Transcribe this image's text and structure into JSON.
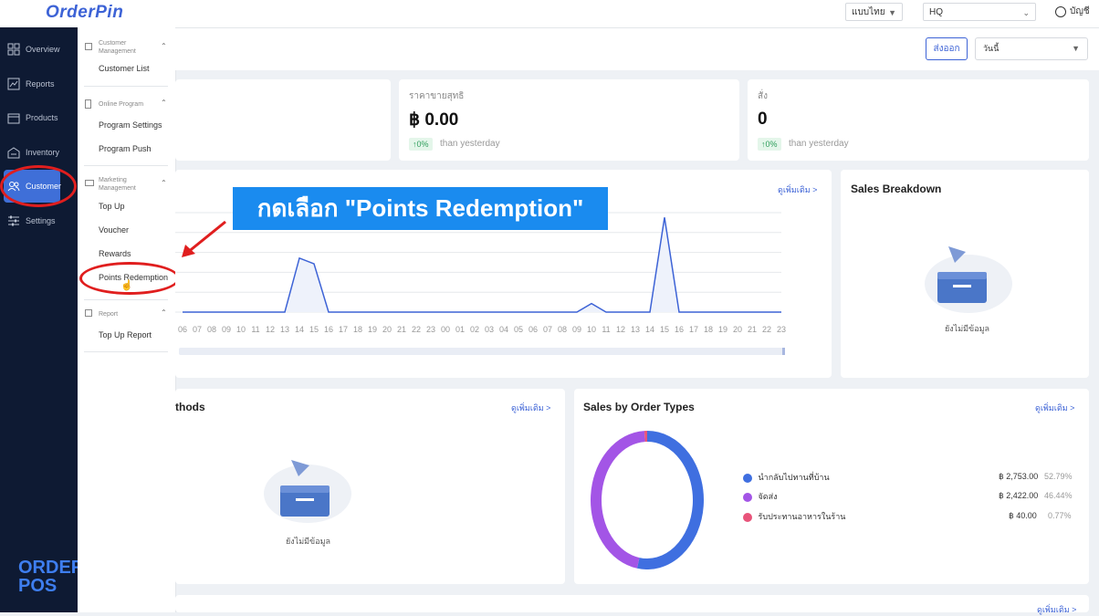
{
  "app": {
    "logo": "OrderPin"
  },
  "topbar": {
    "language": "แบบไทย",
    "branch": "HQ",
    "account": "บัญชี"
  },
  "rail": {
    "items": [
      {
        "label": "Overview",
        "icon": "grid-icon"
      },
      {
        "label": "Reports",
        "icon": "report-icon"
      },
      {
        "label": "Products",
        "icon": "box-icon"
      },
      {
        "label": "Inventory",
        "icon": "inventory-icon"
      },
      {
        "label": "Customer",
        "icon": "users-icon"
      },
      {
        "label": "Settings",
        "icon": "sliders-icon"
      }
    ],
    "brand_line1": "ORDER",
    "brand_line2": "POS"
  },
  "submenu": {
    "groups": [
      {
        "title": "Customer Management",
        "items": [
          "Customer List"
        ]
      },
      {
        "title": "Online Program",
        "items": [
          "Program Settings",
          "Program Push"
        ]
      },
      {
        "title": "Marketing Management",
        "items": [
          "Top Up",
          "Voucher",
          "Rewards",
          "Points Redemption"
        ]
      },
      {
        "title": "Report",
        "items": [
          "Top Up Report"
        ]
      }
    ]
  },
  "toolbar": {
    "export": "ส่งออก",
    "date": "วันนี้"
  },
  "stats": [
    {
      "label": "ราคาขายสุทธิ",
      "value": "฿ 0.00",
      "change": "↑0%",
      "than": "than yesterday"
    },
    {
      "label": "สั่ง",
      "value": "0",
      "change": "↑0%",
      "than": "than yesterday"
    }
  ],
  "callout": "กดเลือก \"Points Redemption\"",
  "line_card": {
    "more": "ดูเพิ่มเติม >"
  },
  "breakdown": {
    "title": "Sales Breakdown",
    "empty": "ยังไม่มีข้อมูล"
  },
  "methods": {
    "title": "thods",
    "more": "ดูเพิ่มเติม >",
    "empty": "ยังไม่มีข้อมูล"
  },
  "ordertypes": {
    "title": "Sales by Order Types",
    "more": "ดูเพิ่มเติม >",
    "legend": [
      {
        "name": "นำกลับไปทานที่บ้าน",
        "amount": "฿ 2,753.00",
        "pct": "52.79%",
        "color": "#3f6fe0"
      },
      {
        "name": "จัดส่ง",
        "amount": "฿ 2,422.00",
        "pct": "46.44%",
        "color": "#a355e6"
      },
      {
        "name": "รับประทานอาหารในร้าน",
        "amount": "฿ 40.00",
        "pct": "0.77%",
        "color": "#e8547a"
      }
    ]
  },
  "bottom": {
    "more": "ดูเพิ่มเติม >"
  },
  "chart_data": [
    {
      "type": "line",
      "x": [
        "06",
        "07",
        "08",
        "09",
        "10",
        "11",
        "12",
        "13",
        "14",
        "15",
        "16",
        "17",
        "18",
        "19",
        "20",
        "21",
        "22",
        "23",
        "00",
        "01",
        "02",
        "03",
        "04",
        "05",
        "06",
        "07",
        "08",
        "09",
        "10",
        "11",
        "12",
        "13",
        "14",
        "15",
        "16",
        "17",
        "18",
        "19",
        "20",
        "21",
        "22",
        "23"
      ],
      "values": [
        0,
        0,
        0,
        0,
        0,
        0,
        0,
        0,
        57,
        51,
        0,
        0,
        0,
        0,
        0,
        0,
        0,
        0,
        0,
        0,
        0,
        0,
        0,
        0,
        0,
        0,
        0,
        0,
        9,
        0,
        0,
        0,
        0,
        100,
        0,
        0,
        0,
        0,
        0,
        0,
        0,
        0
      ],
      "ylim": [
        0,
        105
      ],
      "grid": true,
      "color": "#3d63d6"
    },
    {
      "type": "pie",
      "categories": [
        "นำกลับไปทานที่บ้าน",
        "จัดส่ง",
        "รับประทานอาหารในร้าน"
      ],
      "values": [
        52.79,
        46.44,
        0.77
      ],
      "colors": [
        "#3f6fe0",
        "#a355e6",
        "#e8547a"
      ]
    }
  ]
}
